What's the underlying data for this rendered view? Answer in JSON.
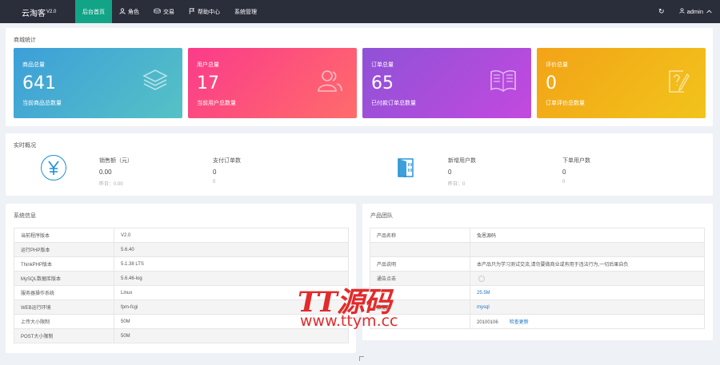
{
  "topbar": {
    "app_name": "云淘客",
    "version": "V2.0",
    "nav": [
      {
        "label": "后台首页",
        "icon": ""
      },
      {
        "label": "角色",
        "icon": "user-icon"
      },
      {
        "label": "交易",
        "icon": "coins-icon"
      },
      {
        "label": "帮助中心",
        "icon": "flag-icon"
      },
      {
        "label": "系统管理",
        "icon": ""
      }
    ],
    "refresh_icon": "refresh-icon",
    "user": "admin"
  },
  "mall_stats": {
    "title": "商城统计",
    "cards": [
      {
        "label": "商品总量",
        "value": "641",
        "sub": "当前商品总数量",
        "icon": "layers-icon",
        "color_from": "#3d9fd9",
        "color_to": "#55c2c5"
      },
      {
        "label": "用户总量",
        "value": "17",
        "sub": "当前用户总数量",
        "icon": "users-icon",
        "color_from": "#fb3b8a",
        "color_to": "#ff6c6b"
      },
      {
        "label": "订单总量",
        "value": "65",
        "sub": "已付款订单总数量",
        "icon": "book-icon",
        "color_from": "#8f52d7",
        "color_to": "#c349df"
      },
      {
        "label": "评价总量",
        "value": "0",
        "sub": "订单评价总数量",
        "icon": "question-edit-icon",
        "color_from": "#f3a317",
        "color_to": "#f1c41b"
      }
    ]
  },
  "realtime": {
    "title": "实时概况",
    "items": [
      {
        "label": "销售额（元）",
        "value": "0.00",
        "yesterday": "昨日：0.00"
      },
      {
        "label": "支付订单数",
        "value": "0",
        "yesterday": "0"
      },
      {
        "label": "新增用户数",
        "value": "0",
        "yesterday": "昨日：0"
      },
      {
        "label": "下单用户数",
        "value": "0",
        "yesterday": "0"
      }
    ],
    "colors": {
      "accent": "#1b8fd4"
    }
  },
  "system_info": {
    "title": "系统信息",
    "rows": [
      {
        "k": "当前程序版本",
        "v": "V2.0"
      },
      {
        "k": "运行PHP版本",
        "v": "5.6.40"
      },
      {
        "k": "ThinkPHP版本",
        "v": "5.1.38 LTS"
      },
      {
        "k": "MySQL数据库版本",
        "v": "5.6.46-log"
      },
      {
        "k": "服务器操作系统",
        "v": "Linux"
      },
      {
        "k": "WEB运行环境",
        "v": "fpm-fcgi"
      },
      {
        "k": "上传大小限制",
        "v": "50M"
      },
      {
        "k": "POST大小限制",
        "v": "50M"
      }
    ]
  },
  "team": {
    "title": "产品团队",
    "rows": [
      {
        "k": "产品名称",
        "v": "兔恩源码"
      },
      {
        "k": "",
        "v": ""
      },
      {
        "k": "产品说明",
        "v": "本产品只为学习测试交流,请勿要做商业或有用于违法行为,一切后果自负"
      },
      {
        "k": "通告点击",
        "v": ""
      },
      {
        "k": "",
        "v": "25.5M"
      },
      {
        "k": "数据库",
        "v": "mysql"
      },
      {
        "k": "",
        "v": "20100106",
        "link": "检查更新"
      }
    ]
  },
  "watermark": {
    "text": "TT源码",
    "url": "www.ttym.cc"
  }
}
